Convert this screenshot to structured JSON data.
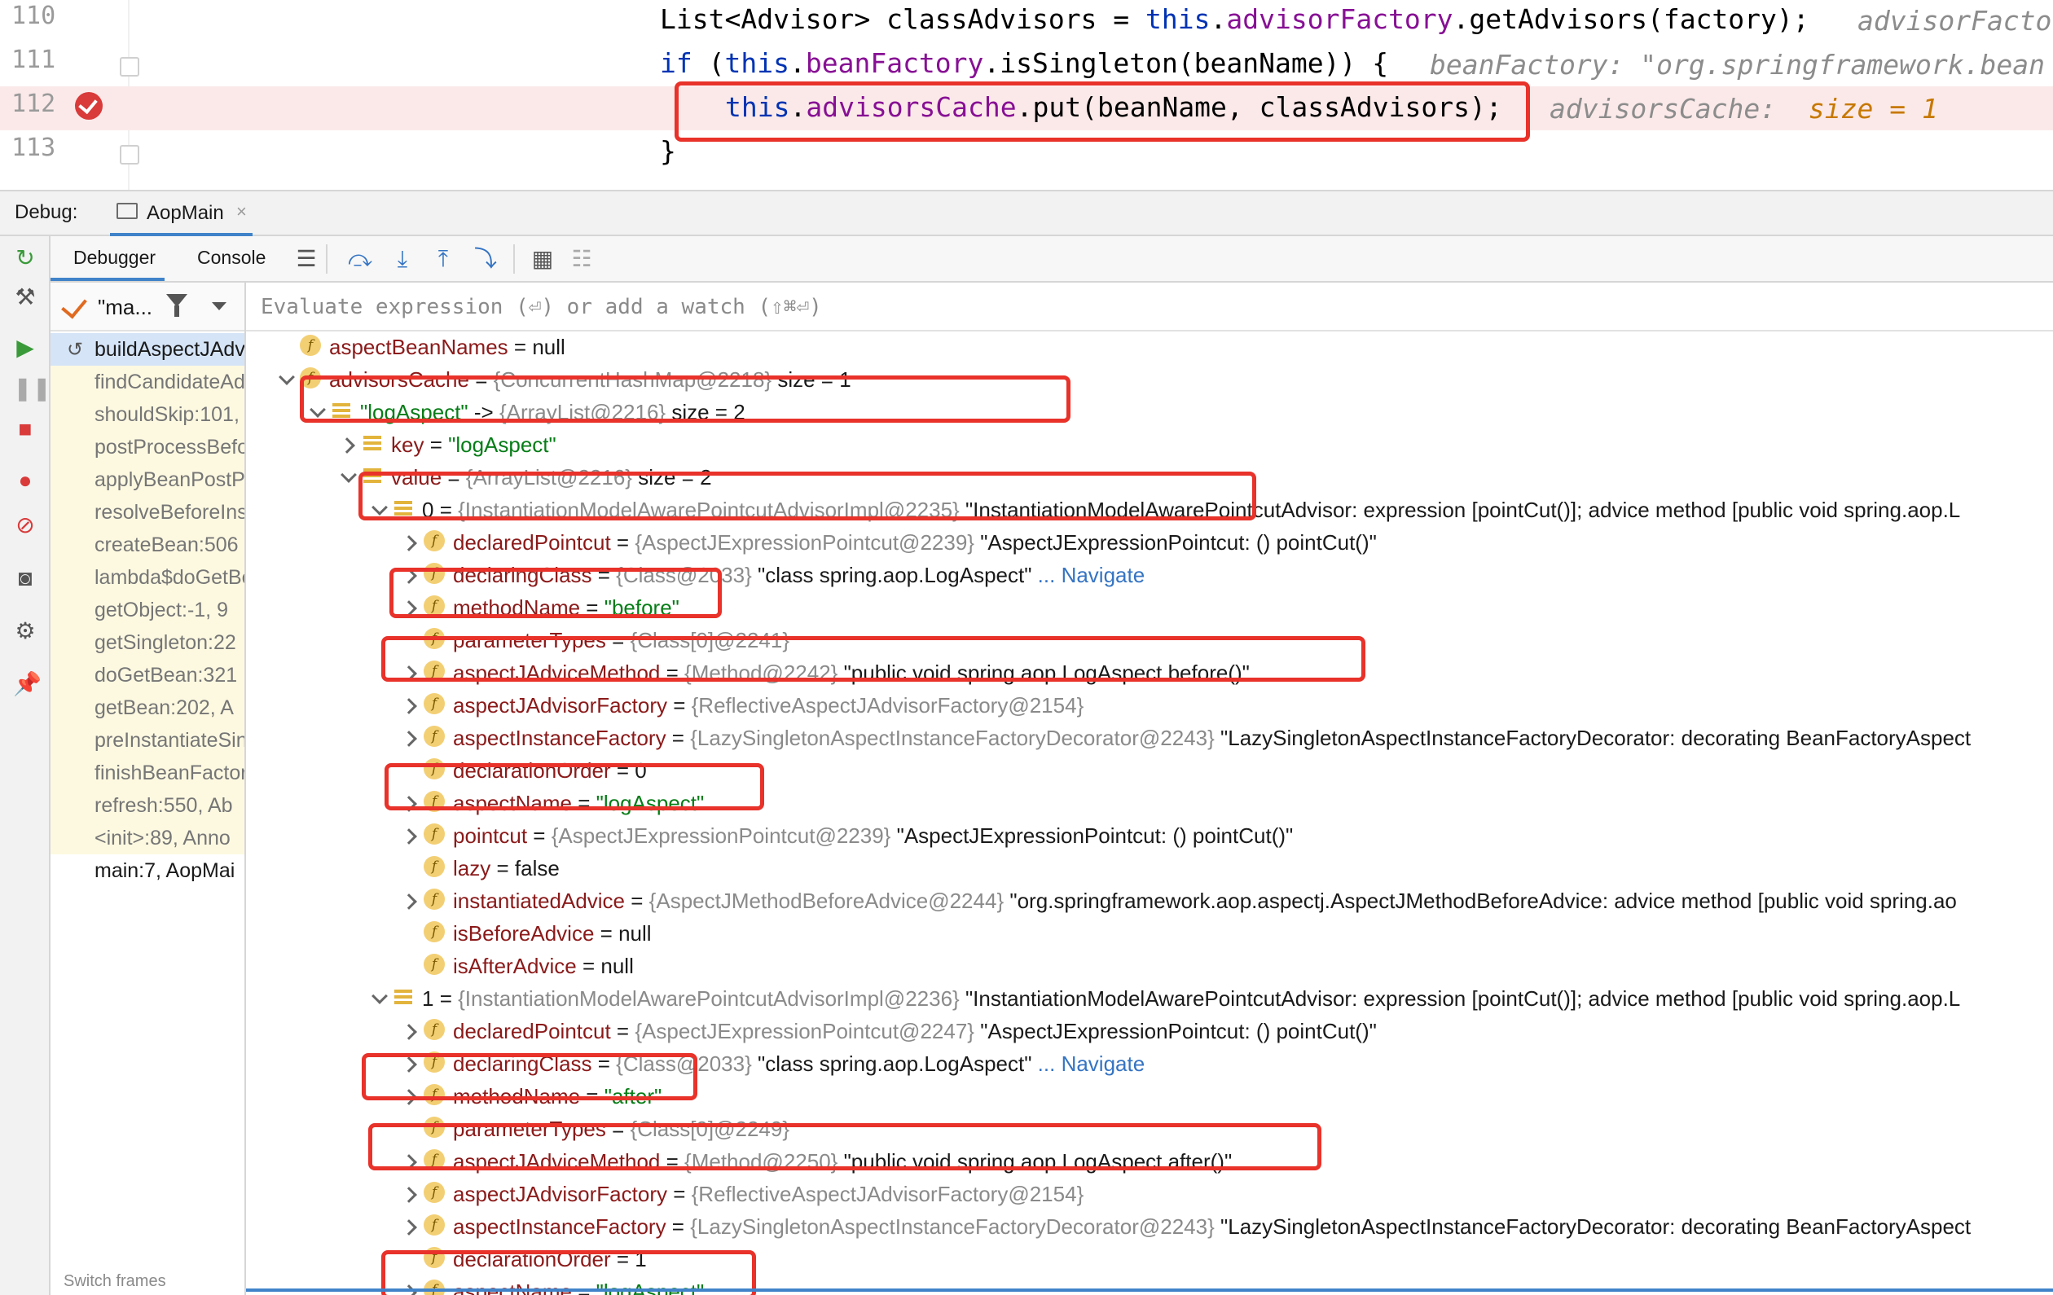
{
  "editor": {
    "lines": [
      {
        "number": "110",
        "code_parts": [
          [
            "plain",
            "List<Advisor> classAdvisors = "
          ],
          [
            "kw",
            "this"
          ],
          [
            "plain",
            "."
          ],
          [
            "fld",
            "advisorFactory"
          ],
          [
            "plain",
            ".getAdvisors(factory);"
          ]
        ],
        "inline": "advisorFacto"
      },
      {
        "number": "111",
        "code_parts": [
          [
            "kw",
            "if"
          ],
          [
            "plain",
            " ("
          ],
          [
            "kw",
            "this"
          ],
          [
            "plain",
            "."
          ],
          [
            "fld",
            "beanFactory"
          ],
          [
            "plain",
            ".isSingleton(beanName)) {"
          ]
        ],
        "inline": "beanFactory: \"org.springframework.bean"
      },
      {
        "number": "112",
        "code_parts": [
          [
            "kw",
            "this"
          ],
          [
            "plain",
            "."
          ],
          [
            "fld",
            "advisorsCache"
          ],
          [
            "plain",
            ".put(beanName, classAdvisors);"
          ]
        ],
        "inline_label": "advisorsCache:",
        "inline_value": "size = 1"
      },
      {
        "number": "113",
        "code_parts": [
          [
            "plain",
            "}"
          ]
        ],
        "inline": ""
      }
    ]
  },
  "debugbar": {
    "label": "Debug:",
    "tab": "AopMain"
  },
  "toolbar": {
    "debugger_tab": "Debugger",
    "console_tab": "Console"
  },
  "frames": {
    "thread": "\"ma...",
    "items": [
      "buildAspectJAdvisors",
      "findCandidateAdvisors",
      "shouldSkip:101,",
      "postProcessBefore",
      "applyBeanPostProcessors",
      "resolveBeforeInstantiation",
      "createBean:506",
      "lambda$doGetBean",
      "getObject:-1, 9",
      "getSingleton:22",
      "doGetBean:321",
      "getBean:202, A",
      "preInstantiateSingletons",
      "finishBeanFactory",
      "refresh:550, Ab",
      "<init>:89, Anno",
      "main:7, AopMai"
    ],
    "switch_label": "Switch frames"
  },
  "evaluate": {
    "placeholder": "Evaluate expression (⏎) or add a watch (⇧⌘⏎)"
  },
  "variables": [
    {
      "indent": 0,
      "arrow": "",
      "icon": "f",
      "name": "aspectBeanNames",
      "ref": "",
      "val": "null",
      "type": "val"
    },
    {
      "indent": 0,
      "arrow": "down",
      "icon": "f",
      "name": "advisorsCache",
      "ref": "{ConcurrentHashMap@2218}",
      "val": "size = 1",
      "type": "val"
    },
    {
      "indent": 1,
      "arrow": "down",
      "icon": "l",
      "name": "\"logAspect\"",
      "sep": " -> ",
      "ref": "{ArrayList@2216}",
      "val": "size = 2",
      "type": "val",
      "namestr": true
    },
    {
      "indent": 2,
      "arrow": "right",
      "icon": "l",
      "name": "key",
      "ref": "",
      "val": "\"logAspect\"",
      "type": "str"
    },
    {
      "indent": 2,
      "arrow": "down",
      "icon": "l",
      "name": "value",
      "ref": "{ArrayList@2216}",
      "val": "size = 2",
      "type": "val"
    },
    {
      "indent": 3,
      "arrow": "down",
      "icon": "l",
      "name": "0",
      "ref": "{InstantiationModelAwarePointcutAdvisorImpl@2235}",
      "val": "\"InstantiationModelAwarePointcutAdvisor: expression [pointCut()]; advice method [public void spring.aop.L",
      "type": "val",
      "plainname": true
    },
    {
      "indent": 4,
      "arrow": "right",
      "icon": "f",
      "name": "declaredPointcut",
      "ref": "{AspectJExpressionPointcut@2239}",
      "val": "\"AspectJExpressionPointcut: () pointCut()\"",
      "type": "val"
    },
    {
      "indent": 4,
      "arrow": "right",
      "icon": "f",
      "name": "declaringClass",
      "ref": "{Class@2033}",
      "val": "\"class spring.aop.LogAspect\"",
      "nav": "... Navigate",
      "type": "val"
    },
    {
      "indent": 4,
      "arrow": "right",
      "icon": "f",
      "name": "methodName",
      "ref": "",
      "val": "\"before\"",
      "type": "str"
    },
    {
      "indent": 4,
      "arrow": "",
      "icon": "f",
      "name": "parameterTypes",
      "ref": "{Class[0]@2241}",
      "val": "",
      "type": "val"
    },
    {
      "indent": 4,
      "arrow": "right",
      "icon": "f",
      "name": "aspectJAdviceMethod",
      "ref": "{Method@2242}",
      "val": "\"public void spring.aop.LogAspect.before()\"",
      "type": "val"
    },
    {
      "indent": 4,
      "arrow": "right",
      "icon": "f",
      "name": "aspectJAdvisorFactory",
      "ref": "{ReflectiveAspectJAdvisorFactory@2154}",
      "val": "",
      "type": "val"
    },
    {
      "indent": 4,
      "arrow": "right",
      "icon": "f",
      "name": "aspectInstanceFactory",
      "ref": "{LazySingletonAspectInstanceFactoryDecorator@2243}",
      "val": "\"LazySingletonAspectInstanceFactoryDecorator: decorating BeanFactoryAspect",
      "type": "val"
    },
    {
      "indent": 4,
      "arrow": "",
      "icon": "f",
      "name": "declarationOrder",
      "ref": "",
      "val": "0",
      "type": "val"
    },
    {
      "indent": 4,
      "arrow": "right",
      "icon": "f",
      "name": "aspectName",
      "ref": "",
      "val": "\"logAspect\"",
      "type": "str"
    },
    {
      "indent": 4,
      "arrow": "right",
      "icon": "f",
      "name": "pointcut",
      "ref": "{AspectJExpressionPointcut@2239}",
      "val": "\"AspectJExpressionPointcut: () pointCut()\"",
      "type": "val"
    },
    {
      "indent": 4,
      "arrow": "",
      "icon": "f",
      "name": "lazy",
      "ref": "",
      "val": "false",
      "type": "val"
    },
    {
      "indent": 4,
      "arrow": "right",
      "icon": "f",
      "name": "instantiatedAdvice",
      "ref": "{AspectJMethodBeforeAdvice@2244}",
      "val": "\"org.springframework.aop.aspectj.AspectJMethodBeforeAdvice: advice method [public void spring.ao",
      "type": "val"
    },
    {
      "indent": 4,
      "arrow": "",
      "icon": "f",
      "name": "isBeforeAdvice",
      "ref": "",
      "val": "null",
      "type": "val"
    },
    {
      "indent": 4,
      "arrow": "",
      "icon": "f",
      "name": "isAfterAdvice",
      "ref": "",
      "val": "null",
      "type": "val"
    },
    {
      "indent": 3,
      "arrow": "down",
      "icon": "l",
      "name": "1",
      "ref": "{InstantiationModelAwarePointcutAdvisorImpl@2236}",
      "val": "\"InstantiationModelAwarePointcutAdvisor: expression [pointCut()]; advice method [public void spring.aop.L",
      "type": "val",
      "plainname": true
    },
    {
      "indent": 4,
      "arrow": "right",
      "icon": "f",
      "name": "declaredPointcut",
      "ref": "{AspectJExpressionPointcut@2247}",
      "val": "\"AspectJExpressionPointcut: () pointCut()\"",
      "type": "val"
    },
    {
      "indent": 4,
      "arrow": "right",
      "icon": "f",
      "name": "declaringClass",
      "ref": "{Class@2033}",
      "val": "\"class spring.aop.LogAspect\"",
      "nav": "... Navigate",
      "type": "val"
    },
    {
      "indent": 4,
      "arrow": "right",
      "icon": "f",
      "name": "methodName",
      "ref": "",
      "val": "\"after\"",
      "type": "str"
    },
    {
      "indent": 4,
      "arrow": "",
      "icon": "f",
      "name": "parameterTypes",
      "ref": "{Class[0]@2249}",
      "val": "",
      "type": "val"
    },
    {
      "indent": 4,
      "arrow": "right",
      "icon": "f",
      "name": "aspectJAdviceMethod",
      "ref": "{Method@2250}",
      "val": "\"public void spring.aop.LogAspect.after()\"",
      "type": "val"
    },
    {
      "indent": 4,
      "arrow": "right",
      "icon": "f",
      "name": "aspectJAdvisorFactory",
      "ref": "{ReflectiveAspectJAdvisorFactory@2154}",
      "val": "",
      "type": "val"
    },
    {
      "indent": 4,
      "arrow": "right",
      "icon": "f",
      "name": "aspectInstanceFactory",
      "ref": "{LazySingletonAspectInstanceFactoryDecorator@2243}",
      "val": "\"LazySingletonAspectInstanceFactoryDecorator: decorating BeanFactoryAspect",
      "type": "val"
    },
    {
      "indent": 4,
      "arrow": "",
      "icon": "f",
      "name": "declarationOrder",
      "ref": "",
      "val": "1",
      "type": "val"
    },
    {
      "indent": 4,
      "arrow": "right",
      "icon": "f",
      "name": "aspectName",
      "ref": "",
      "val": "\"logAspect\"",
      "type": "str"
    }
  ],
  "colors": {
    "highlight_box": "#e8322a",
    "keyword": "#0033b3",
    "field": "#871094",
    "string": "#067d17",
    "var_name": "#8b1a1a",
    "accent": "#4083c9"
  }
}
